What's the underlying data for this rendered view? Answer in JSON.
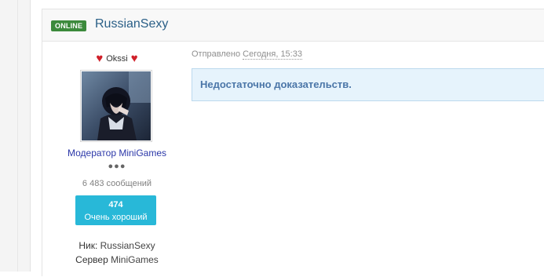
{
  "post": {
    "status_badge": "ONLINE",
    "username": "RussianSexy",
    "sent_label": "Отправлено",
    "sent_time": "Сегодня, 15:33",
    "message": "Недостаточно доказательств."
  },
  "user": {
    "nick_display": "Okssi",
    "role": "Модератор MiniGames",
    "rank_dots": "●●●",
    "message_count": "6 483 сообщений",
    "rating_value": "474",
    "rating_label": "Очень хороший",
    "nick_label": "Ник:",
    "nick_value": "RussianSexy",
    "server_label": "Сервер",
    "server_value": "MiniGames"
  },
  "colors": {
    "online": "#3c8a3c",
    "username": "#2a5f87",
    "role": "#2b37a8",
    "rating_bg": "#28b8d8",
    "quote_bg": "#e6f3fc",
    "quote_text": "#4b76a8",
    "heart": "#d0202a"
  },
  "icons": [
    "heart-icon",
    "avatar-image"
  ]
}
